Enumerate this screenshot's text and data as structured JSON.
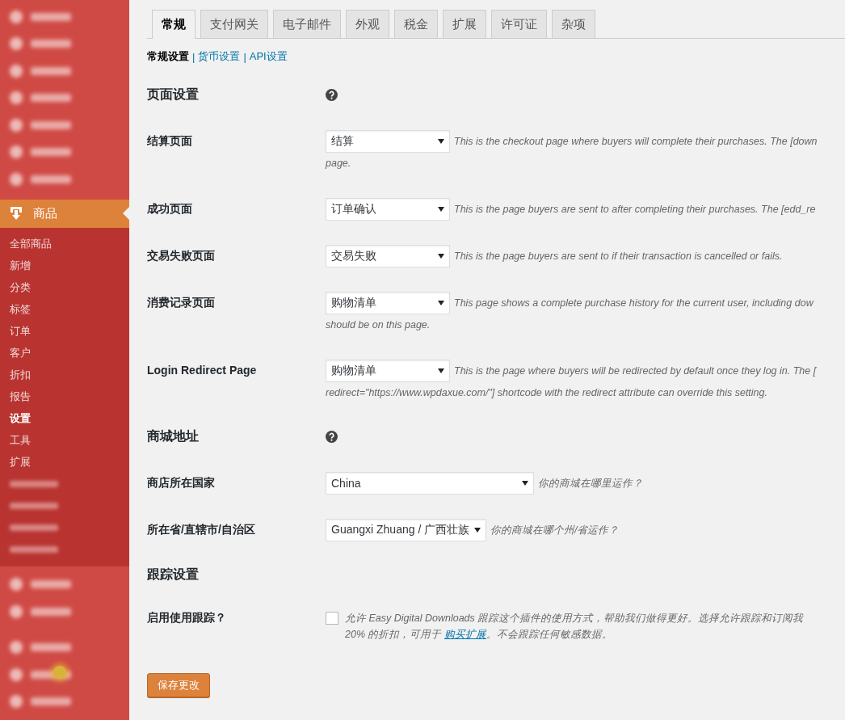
{
  "sidebar": {
    "top_items": [
      {
        "kind": "blurred"
      },
      {
        "kind": "blurred"
      },
      {
        "kind": "blurred"
      },
      {
        "kind": "blurred"
      },
      {
        "kind": "blurred"
      },
      {
        "kind": "blurred"
      },
      {
        "kind": "blurred"
      }
    ],
    "active_item": {
      "label": "商品"
    },
    "submenu": [
      {
        "kind": "item",
        "label": "全部商品",
        "selected": false
      },
      {
        "kind": "item",
        "label": "新增",
        "selected": false
      },
      {
        "kind": "item",
        "label": "分类",
        "selected": false
      },
      {
        "kind": "item",
        "label": "标签",
        "selected": false
      },
      {
        "kind": "item",
        "label": "订单",
        "selected": false
      },
      {
        "kind": "item",
        "label": "客户",
        "selected": false
      },
      {
        "kind": "item",
        "label": "折扣",
        "selected": false
      },
      {
        "kind": "item",
        "label": "报告",
        "selected": false
      },
      {
        "kind": "item",
        "label": "设置",
        "selected": true
      },
      {
        "kind": "item",
        "label": "工具",
        "selected": false
      },
      {
        "kind": "item",
        "label": "扩展",
        "selected": false
      },
      {
        "kind": "blurred"
      },
      {
        "kind": "blurred"
      },
      {
        "kind": "blurred"
      },
      {
        "kind": "blurred"
      }
    ],
    "bottom_items": [
      {
        "kind": "blurred"
      },
      {
        "kind": "blurred"
      },
      {
        "kind": "blurred"
      },
      {
        "kind": "blurred"
      },
      {
        "kind": "blurred"
      }
    ]
  },
  "tabs": [
    {
      "label": "常规",
      "selected": true
    },
    {
      "label": "支付网关",
      "selected": false
    },
    {
      "label": "电子邮件",
      "selected": false
    },
    {
      "label": "外观",
      "selected": false
    },
    {
      "label": "税金",
      "selected": false
    },
    {
      "label": "扩展",
      "selected": false
    },
    {
      "label": "许可证",
      "selected": false
    },
    {
      "label": "杂项",
      "selected": false
    }
  ],
  "subnav_separator": "|",
  "subnav": [
    {
      "label": "常规设置",
      "selected": true
    },
    {
      "label": "货币设置",
      "selected": false
    },
    {
      "label": "API设置",
      "selected": false
    }
  ],
  "sections": [
    {
      "heading": "页面设置",
      "help": true,
      "rows": [
        {
          "kind": "page-select",
          "label": "结算页面",
          "value": "结算",
          "description": [
            "This is the checkout page where buyers will complete their purchases. The [down",
            "page."
          ]
        },
        {
          "kind": "page-select",
          "label": "成功页面",
          "value": "订单确认",
          "description": [
            "This is the page buyers are sent to after completing their purchases. The [edd_re"
          ]
        },
        {
          "kind": "page-select",
          "label": "交易失败页面",
          "value": "交易失败",
          "description": [
            "This is the page buyers are sent to if their transaction is cancelled or fails."
          ]
        },
        {
          "kind": "page-select",
          "label": "消费记录页面",
          "value": "购物清单",
          "description": [
            "This page shows a complete purchase history for the current user, including dow",
            "should be on this page."
          ]
        },
        {
          "kind": "page-select",
          "label": "Login Redirect Page",
          "value": "购物清单",
          "description": [
            "This is the page where buyers will be redirected by default once they log in. The [",
            "redirect=\"https://www.wpdaxue.com/\"] shortcode with the redirect attribute can override this setting."
          ]
        }
      ]
    },
    {
      "heading": "商城地址",
      "help": true,
      "rows": [
        {
          "kind": "country-select",
          "label": "商店所在国家",
          "value": "China",
          "description": [
            "你的商城在哪里运作？"
          ]
        },
        {
          "kind": "region-select",
          "label": "所在省/直辖市/自治区",
          "value": "Guangxi Zhuang / 广西壮族",
          "description": [
            "你的商城在哪个州/省运作？"
          ]
        }
      ]
    },
    {
      "heading": "跟踪设置",
      "help": false,
      "rows": [
        {
          "kind": "checkbox",
          "label": "启用使用跟踪？",
          "checked": false,
          "description": [
            {
              "kind": "text",
              "text": "允许 Easy Digital Downloads 跟踪这个插件的使用方式，帮助我们做得更好。选择允许跟踪和订阅我"
            },
            {
              "kind": "break"
            },
            {
              "kind": "text",
              "text": "20% 的折扣，可用于 "
            },
            {
              "kind": "link",
              "text": "购买扩展"
            },
            {
              "kind": "text",
              "text": "。不会跟踪任何敏感数据。"
            }
          ]
        }
      ]
    }
  ],
  "save_button": {
    "label": "保存更改"
  }
}
